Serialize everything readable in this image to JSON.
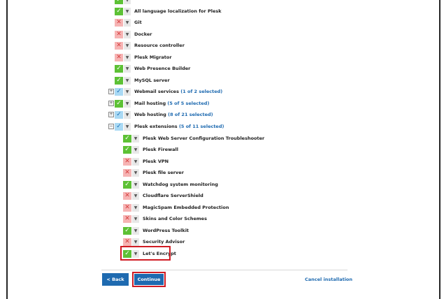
{
  "components": {
    "top_cut": {
      "label": "",
      "state": "yes"
    },
    "localization": {
      "label": "All language localization for Plesk",
      "state": "yes"
    },
    "git": {
      "label": "Git",
      "state": "no"
    },
    "docker": {
      "label": "Docker",
      "state": "no"
    },
    "resource_controller": {
      "label": "Resource controller",
      "state": "no"
    },
    "plesk_migrator": {
      "label": "Plesk Migrator",
      "state": "no"
    },
    "web_presence_builder": {
      "label": "Web Presence Builder",
      "state": "yes"
    },
    "mysql_server": {
      "label": "MySQL server",
      "state": "yes"
    },
    "webmail_services": {
      "label": "Webmail services",
      "selection": "(1 of 2 selected)",
      "state": "partial"
    },
    "mail_hosting": {
      "label": "Mail hosting",
      "selection": "(5 of 5 selected)",
      "state": "yes"
    },
    "web_hosting": {
      "label": "Web hosting",
      "selection": "(8 of 21 selected)",
      "state": "partial"
    },
    "plesk_extensions": {
      "label": "Plesk extensions",
      "selection": "(5 of 11 selected)",
      "state": "partial"
    }
  },
  "extensions": {
    "troubleshooter": {
      "label": "Plesk Web Server Configuration Troubleshooter",
      "state": "yes"
    },
    "firewall": {
      "label": "Plesk Firewall",
      "state": "yes"
    },
    "vpn": {
      "label": "Plesk VPN",
      "state": "no"
    },
    "file_server": {
      "label": "Plesk file server",
      "state": "no"
    },
    "watchdog": {
      "label": "Watchdog system monitoring",
      "state": "yes"
    },
    "cloudflare": {
      "label": "Cloudflare ServerShield",
      "state": "no"
    },
    "magicspam": {
      "label": "MagicSpam Embedded Protection",
      "state": "no"
    },
    "skins": {
      "label": "Skins and Color Schemes",
      "state": "no"
    },
    "wordpress_toolkit": {
      "label": "WordPress Toolkit",
      "state": "yes"
    },
    "security_advisor": {
      "label": "Security Advisor",
      "state": "no"
    },
    "lets_encrypt": {
      "label": "Let's Encrypt",
      "state": "yes"
    }
  },
  "glyphs": {
    "yes": "✓",
    "no": "✕",
    "partial": "✓",
    "dropdown": "▼",
    "expand": "+",
    "collapse": "−"
  },
  "footer": {
    "back_label": "< Back",
    "continue_label": "Continue",
    "cancel_label": "Cancel installation"
  },
  "colors": {
    "accent": "#1e6ab0",
    "check_yes": "#5dc135",
    "check_no": "#f6b4b4",
    "check_partial": "#a9d9f4",
    "highlight": "#d01c24"
  }
}
